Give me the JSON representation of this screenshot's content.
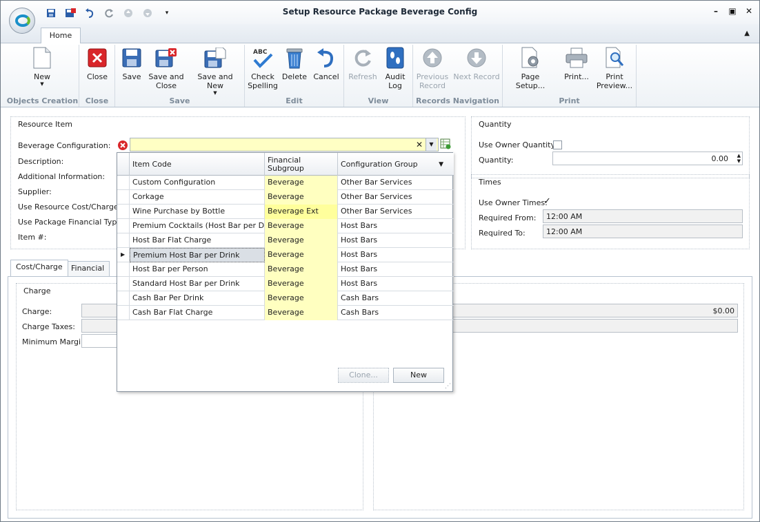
{
  "window": {
    "title": "Setup Resource Package Beverage Config"
  },
  "tabs": {
    "home": "Home"
  },
  "ribbon": {
    "groups": {
      "objects_creation": "Objects Creation",
      "close": "Close",
      "save": "Save",
      "edit": "Edit",
      "view": "View",
      "records_navigation": "Records Navigation",
      "print": "Print"
    },
    "new": "New",
    "close": "Close",
    "save": "Save",
    "save_and_close_1": "Save and",
    "save_and_close_2": "Close",
    "save_and_new": "Save and New",
    "check_spelling_1": "Check",
    "check_spelling_2": "Spelling",
    "delete": "Delete",
    "cancel": "Cancel",
    "refresh": "Refresh",
    "audit_log_1": "Audit",
    "audit_log_2": "Log",
    "previous_record_1": "Previous",
    "previous_record_2": "Record",
    "next_record": "Next Record",
    "page_setup": "Page Setup...",
    "print": "Print...",
    "print_preview_1": "Print",
    "print_preview_2": "Preview..."
  },
  "resource_item": {
    "title": "Resource Item",
    "beverage_configuration": "Beverage Configuration:",
    "description": "Description:",
    "additional_information": "Additional Information:",
    "supplier": "Supplier:",
    "use_resource_cost": "Use Resource Cost/Charge:",
    "use_package_financial": "Use Package Financial Type:",
    "item_no": "Item #:"
  },
  "quantity": {
    "title": "Quantity",
    "use_owner_quantity": "Use Owner Quantity:",
    "quantity_label": "Quantity:",
    "quantity_value": "0.00"
  },
  "times": {
    "title": "Times",
    "use_owner_times": "Use Owner Times:",
    "required_from": "Required From:",
    "required_from_value": "12:00 AM",
    "required_to": "Required To:",
    "required_to_value": "12:00 AM"
  },
  "subtabs": {
    "cost_charge": "Cost/Charge",
    "financial": "Financial"
  },
  "charge": {
    "title": "Charge",
    "charge_label": "Charge:",
    "charge_taxes": "Charge Taxes:",
    "minimum_margin": "Minimum Margin:",
    "right_value": "$0.00"
  },
  "dropdown": {
    "headers": {
      "item_code": "Item Code",
      "financial_subgroup_1": "Financial",
      "financial_subgroup_2": "Subgroup",
      "configuration_group": "Configuration Group"
    },
    "rows": [
      {
        "code": "Custom Configuration",
        "subgroup": "Beverage",
        "group": "Other Bar Services"
      },
      {
        "code": "Corkage",
        "subgroup": "Beverage",
        "group": "Other Bar Services"
      },
      {
        "code": "Wine Purchase by Bottle",
        "subgroup": "Beverage Ext",
        "group": "Other Bar Services"
      },
      {
        "code": "Premium Cocktails (Host Bar per Drink)",
        "subgroup": "Beverage",
        "group": "Host Bars"
      },
      {
        "code": "Host Bar Flat Charge",
        "subgroup": "Beverage",
        "group": "Host Bars"
      },
      {
        "code": "Premium Host Bar per Drink",
        "subgroup": "Beverage",
        "group": "Host Bars"
      },
      {
        "code": "Host Bar per Person",
        "subgroup": "Beverage",
        "group": "Host Bars"
      },
      {
        "code": "Standard Host Bar per Drink",
        "subgroup": "Beverage",
        "group": "Host Bars"
      },
      {
        "code": "Cash Bar Per Drink",
        "subgroup": "Beverage",
        "group": "Cash Bars"
      },
      {
        "code": "Cash Bar Flat Charge",
        "subgroup": "Beverage",
        "group": "Cash Bars"
      }
    ],
    "clone": "Clone...",
    "new": "New"
  },
  "colors": {
    "field_yellow": "#ffffc4",
    "accent": "#1a8fc9",
    "error_red": "#d9262a"
  }
}
